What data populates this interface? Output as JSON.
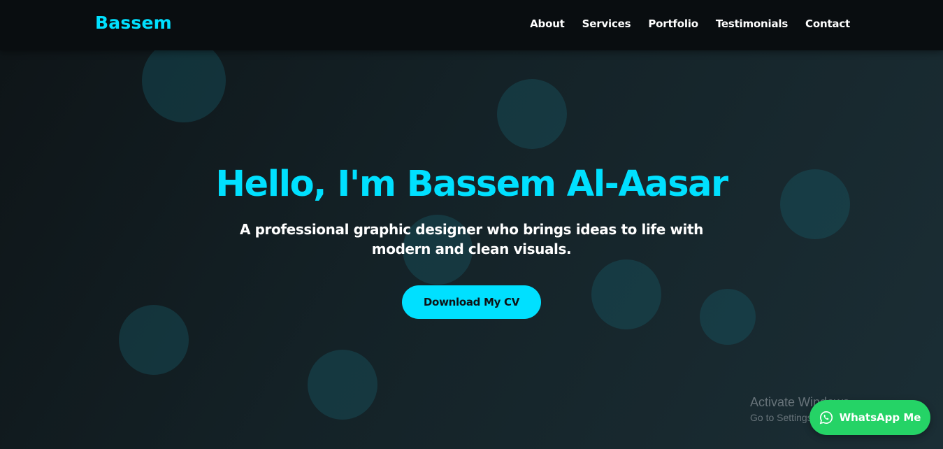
{
  "header": {
    "logo": "Bassem",
    "nav": [
      {
        "label": "About"
      },
      {
        "label": "Services"
      },
      {
        "label": "Portfolio"
      },
      {
        "label": "Testimonials"
      },
      {
        "label": "Contact"
      }
    ]
  },
  "hero": {
    "title": "Hello, I'm Bassem Al-Aasar",
    "subtitle": "A professional graphic designer who brings ideas to life with modern and clean visuals.",
    "cta_label": "Download My CV"
  },
  "whatsapp": {
    "label": "WhatsApp Me",
    "icon": "whatsapp-icon"
  },
  "os_watermark": {
    "line1": "Activate Windows",
    "line2": "Go to Settings to activate Windows."
  },
  "colors": {
    "accent": "#00e0ff",
    "header_bg": "#090d10",
    "whatsapp": "#25d366",
    "text": "#ffffff"
  }
}
